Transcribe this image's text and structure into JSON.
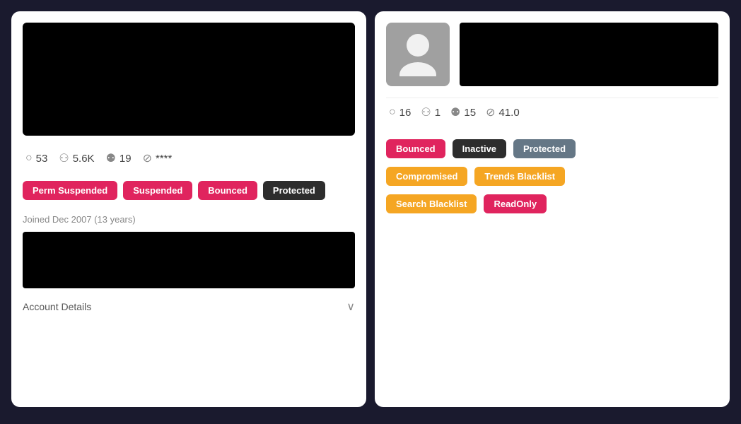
{
  "left_card": {
    "stats": [
      {
        "icon": "💬",
        "value": "53",
        "name": "comments"
      },
      {
        "icon": "👥",
        "value": "5.6K",
        "name": "followers"
      },
      {
        "icon": "👤",
        "value": "19",
        "name": "following"
      },
      {
        "icon": "⊘",
        "value": "****",
        "name": "other"
      }
    ],
    "badges": [
      {
        "label": "Perm Suspended",
        "style": "pink"
      },
      {
        "label": "Suspended",
        "style": "pink"
      },
      {
        "label": "Bounced",
        "style": "pink"
      },
      {
        "label": "Protected",
        "style": "dark"
      }
    ],
    "joined_text": "Joined Dec 2007 (13 years)",
    "account_details_label": "Account Details"
  },
  "right_card": {
    "stats": [
      {
        "icon": "💬",
        "value": "16",
        "name": "comments"
      },
      {
        "icon": "👥",
        "value": "1",
        "name": "followers"
      },
      {
        "icon": "👤",
        "value": "15",
        "name": "following"
      },
      {
        "icon": "⊘",
        "value": "41.0",
        "name": "other"
      }
    ],
    "badges_row1": [
      {
        "label": "Bounced",
        "style": "pink"
      },
      {
        "label": "Inactive",
        "style": "dark"
      },
      {
        "label": "Protected",
        "style": "gray"
      }
    ],
    "badges_row2": [
      {
        "label": "Compromised",
        "style": "orange"
      },
      {
        "label": "Trends Blacklist",
        "style": "orange"
      }
    ],
    "badges_row3": [
      {
        "label": "Search Blacklist",
        "style": "orange"
      },
      {
        "label": "ReadOnly",
        "style": "pink"
      }
    ]
  },
  "icons": {
    "chevron_down": "∨",
    "comment": "○",
    "followers": "⦾⦾",
    "following": "⦾+",
    "slash": "⊘"
  }
}
